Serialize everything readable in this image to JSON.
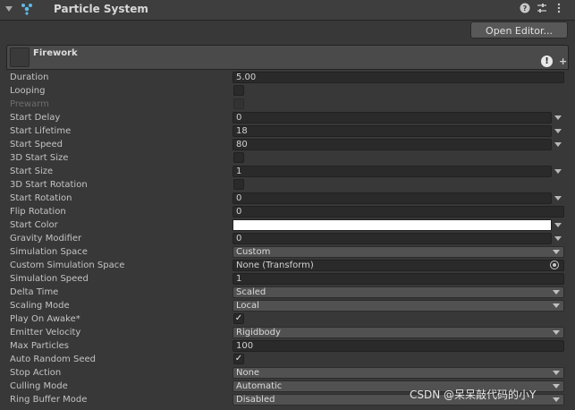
{
  "header": {
    "title": "Particle System",
    "icons": [
      "particle-system-icon",
      "help-icon",
      "presets-icon",
      "more-options-icon"
    ]
  },
  "open_editor_label": "Open Editor...",
  "module": {
    "name": "Firework",
    "warning_symbol": "!",
    "add_symbol": "+"
  },
  "properties": {
    "duration": {
      "label": "Duration",
      "value": "5.00"
    },
    "looping": {
      "label": "Looping",
      "checked": false
    },
    "prewarm": {
      "label": "Prewarm",
      "checked": false
    },
    "start_delay": {
      "label": "Start Delay",
      "value": "0"
    },
    "start_lifetime": {
      "label": "Start Lifetime",
      "value": "18"
    },
    "start_speed": {
      "label": "Start Speed",
      "value": "80"
    },
    "three_d_start_size": {
      "label": "3D Start Size",
      "checked": false
    },
    "start_size": {
      "label": "Start Size",
      "value": "1"
    },
    "three_d_start_rotation": {
      "label": "3D Start Rotation",
      "checked": false
    },
    "start_rotation": {
      "label": "Start Rotation",
      "value": "0"
    },
    "flip_rotation": {
      "label": "Flip Rotation",
      "value": "0"
    },
    "start_color": {
      "label": "Start Color",
      "color": "#ffffff"
    },
    "gravity_modifier": {
      "label": "Gravity Modifier",
      "value": "0"
    },
    "simulation_space": {
      "label": "Simulation Space",
      "value": "Custom"
    },
    "custom_simulation_space": {
      "label": "Custom Simulation Space",
      "value": "None (Transform)"
    },
    "simulation_speed": {
      "label": "Simulation Speed",
      "value": "1"
    },
    "delta_time": {
      "label": "Delta Time",
      "value": "Scaled"
    },
    "scaling_mode": {
      "label": "Scaling Mode",
      "value": "Local"
    },
    "play_on_awake": {
      "label": "Play On Awake*",
      "checked": true,
      "check_symbol": "✓"
    },
    "emitter_velocity": {
      "label": "Emitter Velocity",
      "value": "Rigidbody"
    },
    "max_particles": {
      "label": "Max Particles",
      "value": "100"
    },
    "auto_random_seed": {
      "label": "Auto Random Seed",
      "checked": true,
      "check_symbol": "✓"
    },
    "stop_action": {
      "label": "Stop Action",
      "value": "None"
    },
    "culling_mode": {
      "label": "Culling Mode",
      "value": "Automatic"
    },
    "ring_buffer_mode": {
      "label": "Ring Buffer Mode",
      "value": "Disabled"
    }
  },
  "watermark": "CSDN @呆呆敲代码的小Y",
  "colors": {
    "background": "#383838",
    "field": "#2a2a2a",
    "dropdown": "#515151",
    "start_color": "#ffffff"
  }
}
